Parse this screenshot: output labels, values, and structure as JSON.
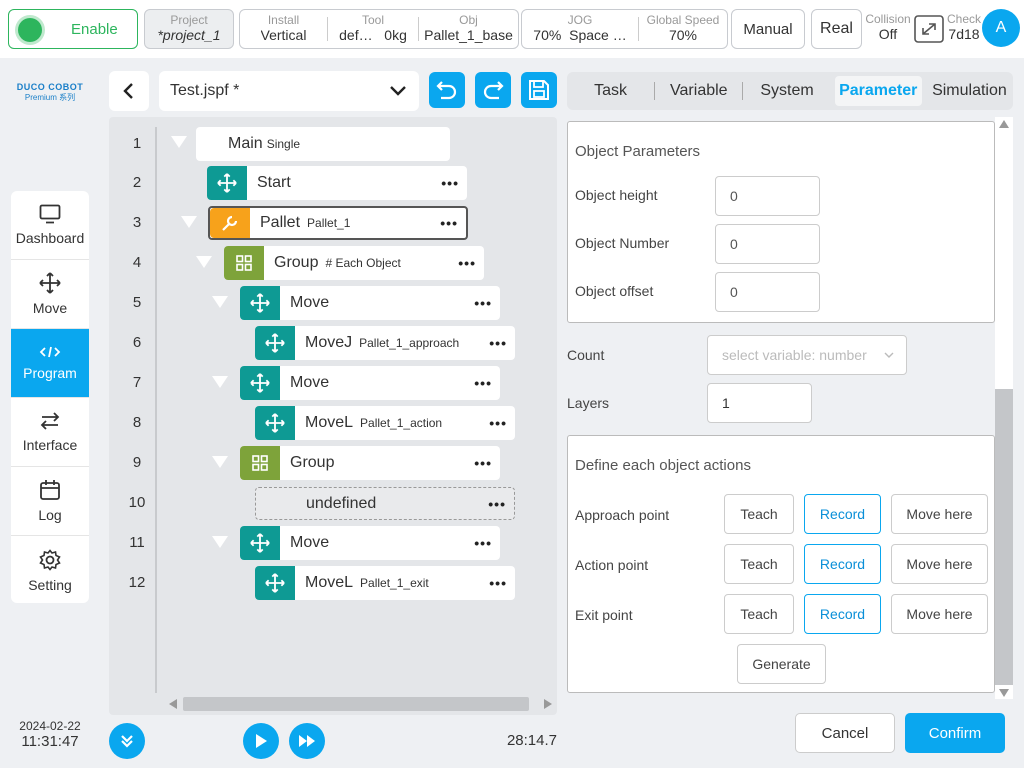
{
  "topbar": {
    "enable_label": "Enable",
    "project": {
      "label": "Project",
      "value": "*project_1"
    },
    "install": {
      "label": "Install",
      "value": "Vertical"
    },
    "tool": {
      "label": "Tool",
      "value1": "def…",
      "value2": "0kg"
    },
    "obj": {
      "label": "Obj",
      "value": "Pallet_1_base"
    },
    "jog": {
      "label": "JOG",
      "value1": "70%",
      "value2": "Space …"
    },
    "global_speed": {
      "label": "Global Speed",
      "value": "70%"
    },
    "mode": "Manual",
    "real": "Real",
    "collision": {
      "label": "Collision",
      "value": "Off"
    },
    "check": {
      "label": "Check",
      "value": "7d18"
    },
    "avatar": "A"
  },
  "brand": {
    "name": "DUCO COBOT",
    "sub": "Premium 系列"
  },
  "nav": [
    {
      "label": "Dashboard",
      "icon": "monitor-icon"
    },
    {
      "label": "Move",
      "icon": "move-icon"
    },
    {
      "label": "Program",
      "icon": "code-icon"
    },
    {
      "label": "Interface",
      "icon": "swap-icon"
    },
    {
      "label": "Log",
      "icon": "calendar-icon"
    },
    {
      "label": "Setting",
      "icon": "gear-icon"
    }
  ],
  "datetime": {
    "date": "2024-02-22",
    "time": "11:31:47"
  },
  "program": {
    "file": "Test.jspf *",
    "elapsed": "28:14.7"
  },
  "tree": [
    {
      "num": "1",
      "name": "Main",
      "sub": "Single"
    },
    {
      "num": "2",
      "name": "Start",
      "sub": ""
    },
    {
      "num": "3",
      "name": "Pallet",
      "sub": "Pallet_1"
    },
    {
      "num": "4",
      "name": "Group",
      "sub": "# Each Object"
    },
    {
      "num": "5",
      "name": "Move",
      "sub": ""
    },
    {
      "num": "6",
      "name": "MoveJ",
      "sub": "Pallet_1_approach"
    },
    {
      "num": "7",
      "name": "Move",
      "sub": ""
    },
    {
      "num": "8",
      "name": "MoveL",
      "sub": "Pallet_1_action"
    },
    {
      "num": "9",
      "name": "Group",
      "sub": ""
    },
    {
      "num": "10",
      "name": "undefined",
      "sub": ""
    },
    {
      "num": "11",
      "name": "Move",
      "sub": ""
    },
    {
      "num": "12",
      "name": "MoveL",
      "sub": "Pallet_1_exit"
    }
  ],
  "tabs": [
    "Task",
    "Variable",
    "System",
    "Parameter",
    "Simulation"
  ],
  "active_tab": "Parameter",
  "params": {
    "object_title": "Object Parameters",
    "object_height": {
      "label": "Object height",
      "value": "0"
    },
    "object_number": {
      "label": "Object Number",
      "value": "0"
    },
    "object_offset": {
      "label": "Object offset",
      "value": "0"
    },
    "count": {
      "label": "Count",
      "placeholder": "select variable: number"
    },
    "layers": {
      "label": "Layers",
      "value": "1"
    },
    "actions_title": "Define each object actions",
    "points": [
      {
        "label": "Approach point"
      },
      {
        "label": "Action point"
      },
      {
        "label": "Exit point"
      }
    ],
    "teach": "Teach",
    "record": "Record",
    "move_here": "Move here",
    "generate": "Generate"
  },
  "footer": {
    "cancel": "Cancel",
    "confirm": "Confirm"
  },
  "colors": {
    "accent": "#0aa7ef",
    "teal": "#0e9a94",
    "orange": "#f7a21b",
    "olive": "#7ea33a",
    "enable_green": "#2db55d"
  }
}
